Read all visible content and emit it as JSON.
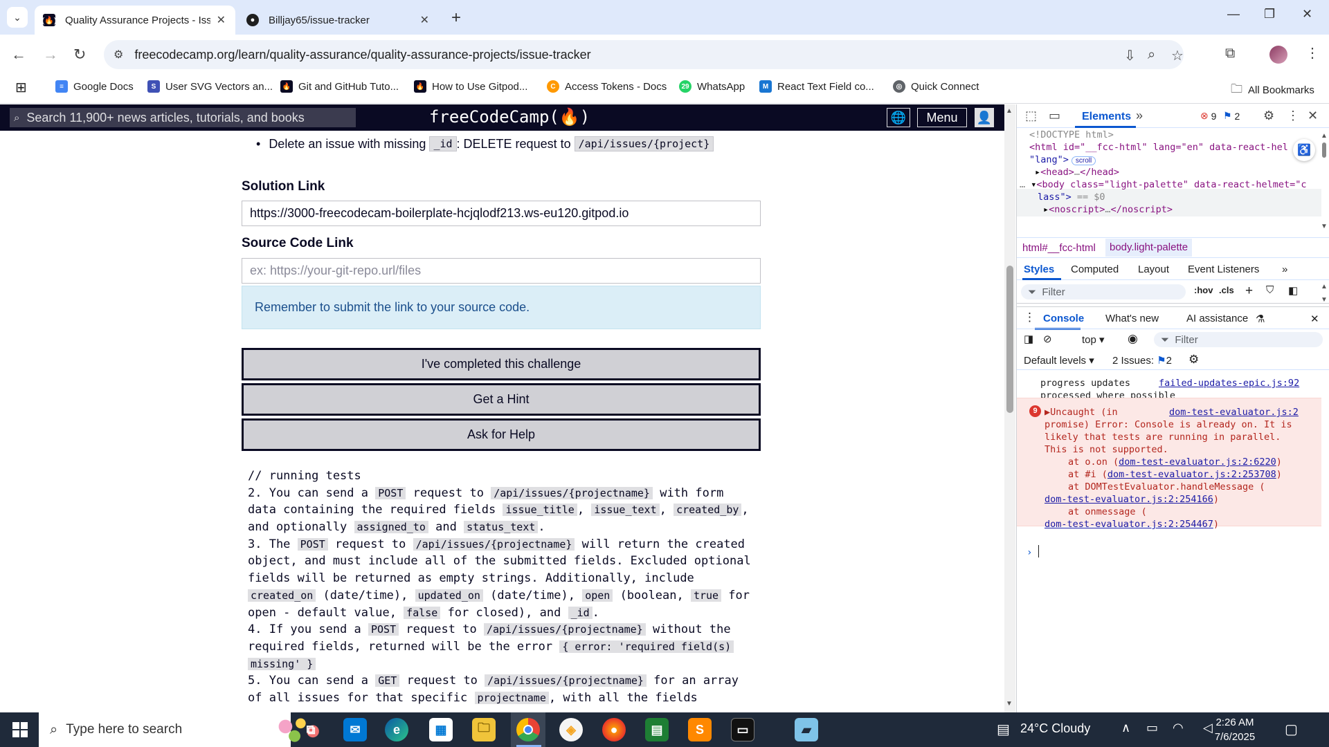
{
  "browser": {
    "tabs": [
      {
        "title": "Quality Assurance Projects - Iss",
        "active": true
      },
      {
        "title": "Billjay65/issue-tracker",
        "active": false
      }
    ],
    "url": "freecodecamp.org/learn/quality-assurance/quality-assurance-projects/issue-tracker",
    "bookmarks": [
      {
        "label": "Google Docs",
        "icon_color": "#4285f4"
      },
      {
        "label": "User SVG Vectors an...",
        "icon_color": "#3f51b5"
      },
      {
        "label": "Git and GitHub Tuto...",
        "icon_color": "#0a0a23"
      },
      {
        "label": "How to Use Gitpod...",
        "icon_color": "#0a0a23"
      },
      {
        "label": "Access Tokens - Docs",
        "icon_color": "#ff9900"
      },
      {
        "label": "WhatsApp",
        "icon_color": "#25d366"
      },
      {
        "label": "React Text Field co...",
        "icon_color": "#1976d2"
      },
      {
        "label": "Quick Connect",
        "icon_color": "#5f6368"
      }
    ],
    "all_bookmarks": "All Bookmarks"
  },
  "fcc": {
    "search_placeholder": "Search 11,900+ news articles, tutorials, and books",
    "logo": "freeCodeCamp(🔥)",
    "logo_text": "freeCodeCamp(",
    "logo_end": ")",
    "menu_label": "Menu",
    "bullet": {
      "prefix": "Delete an issue with missing",
      "code1": "_id",
      "middle": ": DELETE request to",
      "code2": "/api/issues/{project}"
    },
    "solution_label": "Solution Link",
    "solution_value": "https://3000-freecodecam-boilerplate-hcjqlodf213.ws-eu120.gitpod.io",
    "source_label": "Source Code Link",
    "source_placeholder": "ex: https://your-git-repo.url/files",
    "notice": "Remember to submit the link to your source code.",
    "buttons": {
      "complete": "I've completed this challenge",
      "hint": "Get a Hint",
      "help": "Ask for Help"
    },
    "tests_header": "// running tests",
    "tests": [
      [
        {
          "t": "2. You can send a "
        },
        {
          "c": "POST"
        },
        {
          "t": " request to "
        },
        {
          "c": "/api/issues/{projectname}"
        },
        {
          "t": " with form"
        }
      ],
      [
        {
          "t": "data containing the required fields "
        },
        {
          "c": "issue_title"
        },
        {
          "t": ", "
        },
        {
          "c": "issue_text"
        },
        {
          "t": ", "
        },
        {
          "c": "created_by"
        },
        {
          "t": ","
        }
      ],
      [
        {
          "t": "and optionally "
        },
        {
          "c": "assigned_to"
        },
        {
          "t": " and "
        },
        {
          "c": "status_text"
        },
        {
          "t": "."
        }
      ],
      [
        {
          "t": "3. The "
        },
        {
          "c": "POST"
        },
        {
          "t": " request to "
        },
        {
          "c": "/api/issues/{projectname}"
        },
        {
          "t": " will return the created"
        }
      ],
      [
        {
          "t": "object, and must include all of the submitted fields. Excluded optional"
        }
      ],
      [
        {
          "t": "fields will be returned as empty strings. Additionally, include"
        }
      ],
      [
        {
          "c": "created_on"
        },
        {
          "t": " (date/time), "
        },
        {
          "c": "updated_on"
        },
        {
          "t": " (date/time), "
        },
        {
          "c": "open"
        },
        {
          "t": " (boolean, "
        },
        {
          "c": "true"
        },
        {
          "t": " for"
        }
      ],
      [
        {
          "t": "open - default value, "
        },
        {
          "c": "false"
        },
        {
          "t": " for closed), and "
        },
        {
          "c": "_id"
        },
        {
          "t": "."
        }
      ],
      [
        {
          "t": "4. If you send a "
        },
        {
          "c": "POST"
        },
        {
          "t": " request to "
        },
        {
          "c": "/api/issues/{projectname}"
        },
        {
          "t": " without the"
        }
      ],
      [
        {
          "t": "required fields, returned will be the error "
        },
        {
          "c": "{ error: 'required field(s)"
        }
      ],
      [
        {
          "c": "missing' }"
        }
      ],
      [
        {
          "t": "5. You can send a "
        },
        {
          "c": "GET"
        },
        {
          "t": " request to "
        },
        {
          "c": "/api/issues/{projectname}"
        },
        {
          "t": " for an array"
        }
      ],
      [
        {
          "t": "of all issues for that specific "
        },
        {
          "c": "projectname"
        },
        {
          "t": ", with all the fields"
        }
      ]
    ]
  },
  "devtools": {
    "tab_elements": "Elements",
    "error_count": "9",
    "issue_count": "2",
    "dom": {
      "doctype": "<!DOCTYPE html>",
      "html_open": "<html id=\"__fcc-html\" lang=\"en\" data-react-hel",
      "html_open_cont": "\"lang\">",
      "scroll_pill": "scroll",
      "head": "<head>",
      "head_close": "</head>",
      "body": "<body class=\"light-palette\" data-react-helmet=\"c",
      "body_cont": "lass\">",
      "body_eq": " == $0",
      "noscript": "<noscript>",
      "noscript_close": "</noscript>",
      "ellipsis": "…"
    },
    "crumbs": [
      "html#__fcc-html",
      "body.light-palette"
    ],
    "styles_tabs": [
      "Styles",
      "Computed",
      "Layout",
      "Event Listeners"
    ],
    "styles_filter": "Filter",
    "hov": ":hov",
    "cls": ".cls",
    "console_tabs": [
      "Console",
      "What's new",
      "AI assistance"
    ],
    "context": "top",
    "console_filter": "Filter",
    "default_levels": "Default levels",
    "issues_label": "2 Issues:",
    "issues_count": "2",
    "messages": {
      "progress1": "progress updates",
      "progress2": "processed where possible",
      "progress_link": "failed-updates-epic.js:92",
      "err_count": "9",
      "err_l1": "▶Uncaught (in",
      "err_link": "dom-test-evaluator.js:2",
      "err_l2": "promise) Error: Console is already on. It is",
      "err_l3": "likely that tests are running in parallel.",
      "err_l4": "This is not supported.",
      "err_l5_pre": "at o.on (",
      "err_l5_link": "dom-test-evaluator.js:2:6220",
      "err_l6_pre": "at #i (",
      "err_l6_link": "dom-test-evaluator.js:2:253708",
      "err_l7": "at DOMTestEvaluator.handleMessage (",
      "err_l8_link": "dom-test-evaluator.js:2:254166",
      "err_l9": "at onmessage (",
      "err_l10_link": "dom-test-evaluator.js:2:254467",
      "close_paren": ")"
    }
  },
  "taskbar": {
    "search_placeholder": "Type here to search",
    "weather": "24°C  Cloudy",
    "time": "2:26 AM",
    "date": "7/6/2025"
  }
}
